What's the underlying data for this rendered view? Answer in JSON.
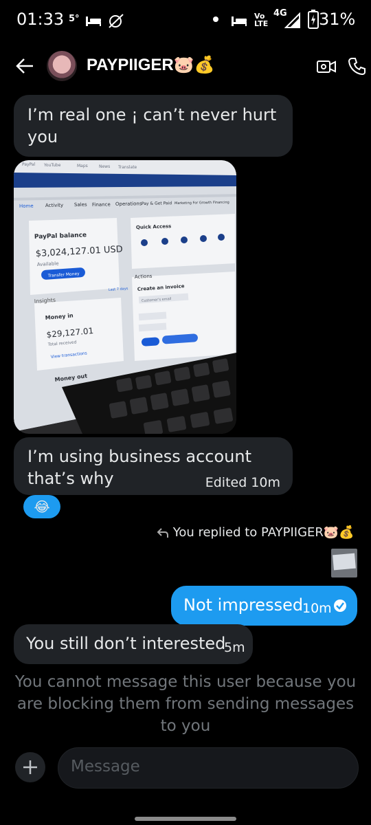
{
  "status_bar": {
    "time": "01:33",
    "temp": "5°",
    "network": "4G",
    "volte": "Vo LTE",
    "battery": "31%"
  },
  "header": {
    "back_icon": "arrow-left-icon",
    "title": "PAYPIIGER🐷💰",
    "video_icon": "video-call-icon",
    "phone_icon": "phone-icon"
  },
  "messages": {
    "msg1": "I’m real one ¡ can’t never hurt you",
    "msg1_line1": "I’m real one ¡ can’t never hurt",
    "msg1_line2": "you",
    "msg2_line1": "I’m using business account",
    "msg2_line2": "that’s why",
    "msg2_meta": "Edited 10m",
    "reaction": "😂",
    "reply_indicator": "You replied to PAYPIIGER🐷💰",
    "msg3": "Not impressed",
    "msg3_time": "10m",
    "msg4": "You still don’t interested",
    "msg4_time": "5m"
  },
  "photo": {
    "tabs": [
      "PayPal",
      "YouTube",
      "Maps",
      "News",
      "Translate"
    ],
    "nav": [
      "Home",
      "Activity",
      "Sales",
      "Finance",
      "Operations",
      "Pay & Get Paid",
      "Marketing For Growth",
      "Financing"
    ],
    "balance_title": "PayPal balance",
    "balance_value": "$3,024,127.01 USD",
    "available": "Available",
    "transfer": "Transfer Money",
    "quick_access": "Quick Access",
    "actions": "Actions",
    "create_invoice": "Create an invoice",
    "customer_email": "Customer's email",
    "insights": "Insights",
    "last7": "Last 7 days",
    "money_in": "Money in",
    "money_in_value": "$29,127.01",
    "total_received": "Total received",
    "view_tx": "View transactions",
    "money_out": "Money out"
  },
  "notice": "You cannot message this user because you are blocking them from sending messages to you",
  "composer": {
    "placeholder": "Message",
    "add_icon": "plus-icon"
  },
  "colors": {
    "background": "#000000",
    "incoming_bubble": "#202327",
    "outgoing_bubble": "#1d9bf0",
    "muted_text": "#71767b"
  }
}
